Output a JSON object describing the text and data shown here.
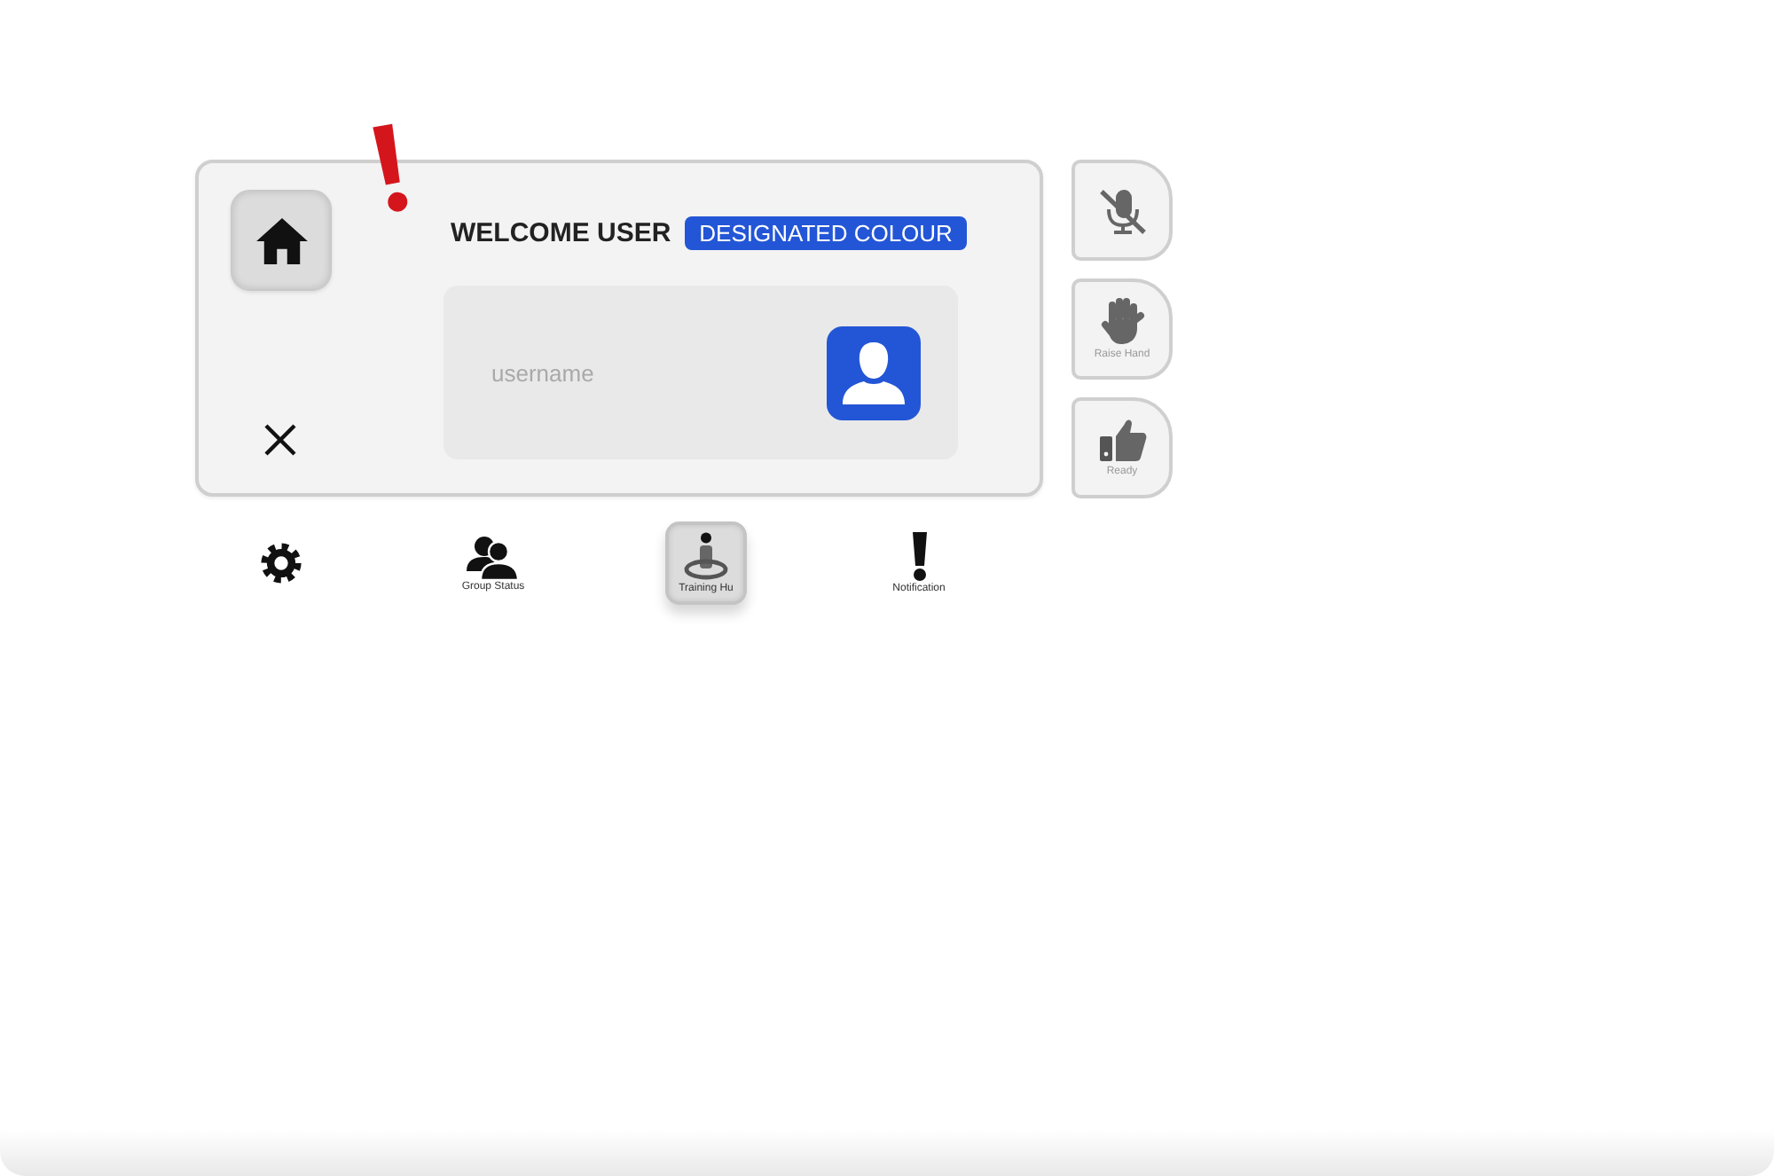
{
  "panel": {
    "welcome": "WELCOME USER",
    "badge": "DESIGNATED COLOUR",
    "username_field": {
      "placeholder": "username"
    }
  },
  "side_buttons": [
    {
      "kind": "mic",
      "muted": true
    },
    {
      "kind": "hand",
      "label": "Raise Hand"
    },
    {
      "kind": "thumb",
      "label": "Ready"
    }
  ],
  "nav": [
    {
      "kind": "settings",
      "selected": false
    },
    {
      "kind": "group",
      "label": "Group Status",
      "selected": false
    },
    {
      "kind": "training",
      "label": "Training Hu",
      "selected": true
    },
    {
      "kind": "alert",
      "label": "Notification",
      "selected": false
    }
  ]
}
